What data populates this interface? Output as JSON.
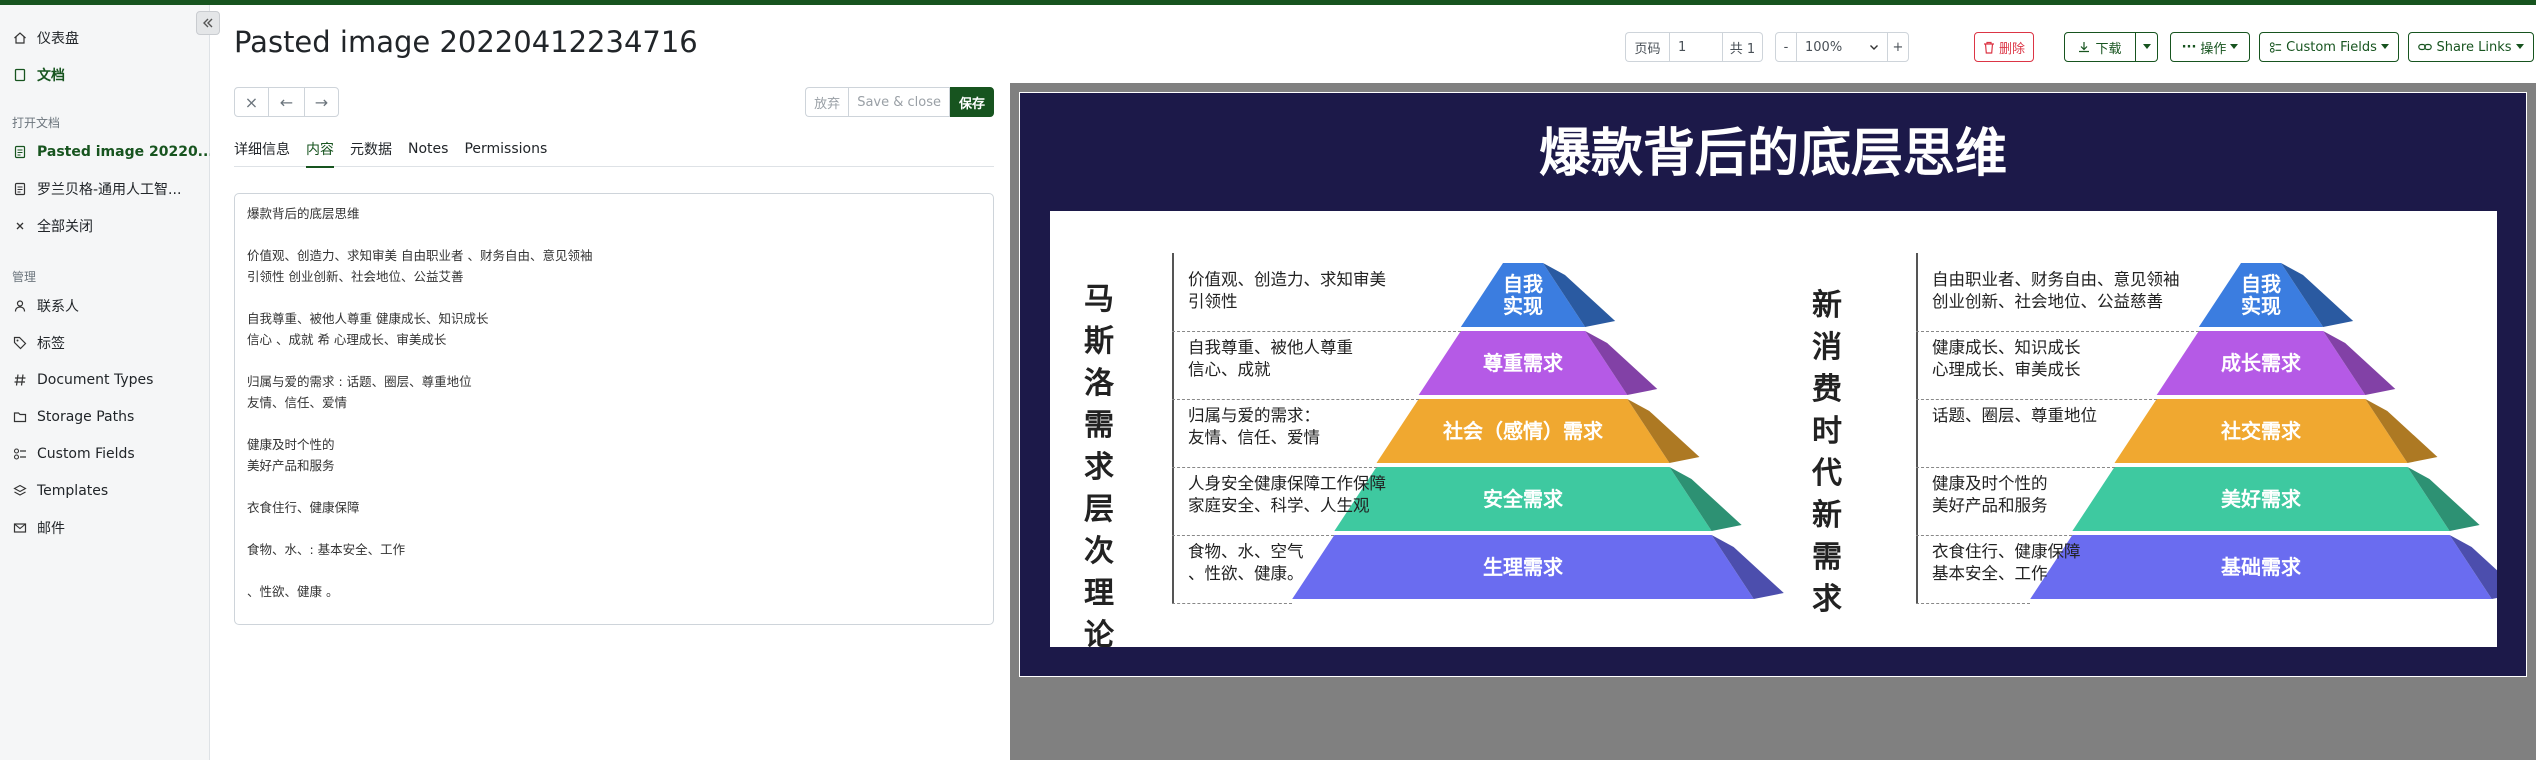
{
  "sidebar": {
    "items": [
      {
        "label": "仪表盘",
        "icon": "house-icon"
      },
      {
        "label": "文档",
        "icon": "file-icon",
        "active": true
      }
    ],
    "open_docs_heading": "打开文档",
    "open_docs": [
      {
        "label": "Pasted image 20220...",
        "active": true
      },
      {
        "label": "罗兰贝格-通用人工智..."
      },
      {
        "label": "全部关闭",
        "icon": "close-icon"
      }
    ],
    "manage_heading": "管理",
    "manage_items": [
      {
        "label": "联系人",
        "icon": "person-icon"
      },
      {
        "label": "标签",
        "icon": "tag-icon"
      },
      {
        "label": "Document Types",
        "icon": "hash-icon"
      },
      {
        "label": "Storage Paths",
        "icon": "folder-icon"
      },
      {
        "label": "Custom Fields",
        "icon": "ui-radios-icon"
      },
      {
        "label": "Templates",
        "icon": "layers-icon"
      },
      {
        "label": "邮件",
        "icon": "envelope-icon"
      }
    ]
  },
  "header": {
    "title": "Pasted image 20220412234716"
  },
  "toolbar": {
    "page_label": "页码",
    "page_value": "1",
    "page_total": "共 1",
    "zoom_minus": "-",
    "zoom_value": "100%",
    "zoom_plus": "+",
    "delete": "删除",
    "download": "下载",
    "actions": "操作",
    "custom_fields": "Custom Fields",
    "share_links": "Share Links"
  },
  "form": {
    "close": "×",
    "prev": "←",
    "next": "→",
    "discard": "放弃",
    "save_close": "Save & close",
    "save": "保存",
    "tabs": [
      "详细信息",
      "内容",
      "元数据",
      "Notes",
      "Permissions"
    ],
    "active_tab": 1,
    "content_lines": [
      "爆款背后的底层思维",
      "",
      "价值观、创造力、求知审美 自由职业者 、财务自由、意见领袖",
      "引领性 创业创新、社会地位、公益艾善",
      "",
      "自我尊重、被他人尊重 健康成长、知识成长",
      "信心 、成就 希 心理成长、审美成长",
      "",
      "归属与爱的需求 : 话题、圈层、尊重地位",
      "友情、信任、爱情",
      "",
      "健康及时个性的",
      "美好产品和服务",
      "",
      "衣食住行、健康保障",
      "",
      "食物、水、: 基本安全、工作",
      "",
      "、性欲、健康 。"
    ]
  },
  "preview": {
    "title": "爆款背后的底层思维",
    "left_vertical": "马斯洛需求层次理论",
    "right_vertical": "新消费时代新需求",
    "left_desc": [
      "价值观、创造力、求知审美\n引领性",
      "自我尊重、被他人尊重\n信心、成就",
      "归属与爱的需求：\n友情、信任、爱情",
      "人身安全健康保障工作保障\n家庭安全、科学、人生观",
      "食物、水、空气\n、性欲、健康。"
    ],
    "left_levels": [
      "自我\n实现",
      "尊重需求",
      "社会（感情）需求",
      "安全需求",
      "生理需求"
    ],
    "right_desc": [
      "自由职业者、财务自由、意见领袖\n创业创新、社会地位、公益慈善",
      "健康成长、知识成长\n心理成长、审美成长",
      "话题、圈层、尊重地位",
      "健康及时个性的\n美好产品和服务",
      "衣食住行、健康保障\n基本安全、工作"
    ],
    "right_levels": [
      "自我\n实现",
      "成长需求",
      "社交需求",
      "美好需求",
      "基础需求"
    ],
    "colors": {
      "level1": "#3b7de0",
      "level2": "#b55ae6",
      "level3": "#f0a830",
      "level4": "#3ec9a0",
      "level5": "#6a6cf0"
    }
  }
}
